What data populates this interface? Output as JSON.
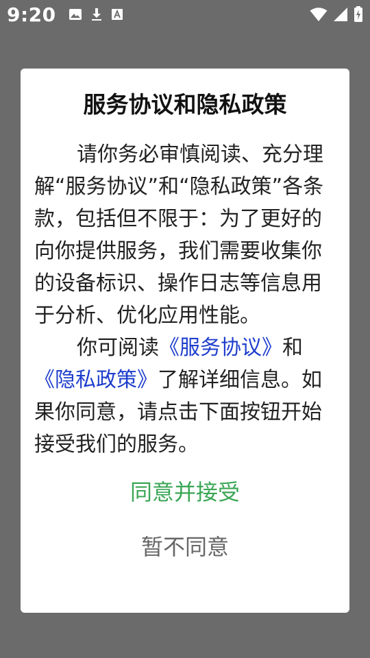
{
  "status_bar": {
    "time": "9:20",
    "icons_left": [
      "image-icon",
      "download-icon",
      "font-a-icon"
    ],
    "icons_right": [
      "wifi-icon",
      "signal-icon",
      "battery-charging-icon"
    ]
  },
  "dialog": {
    "title": "服务协议和隐私政策",
    "paragraph1": "请你务必审慎阅读、充分理解“服务协议”和“隐私政策”各条款，包括但不限于：为了更好的向你提供服务，我们需要收集你的设备标识、操作日志等信息用于分析、优化应用性能。",
    "paragraph2_prefix": "你可阅读",
    "link_service": "《服务协议》",
    "paragraph2_and": "和",
    "link_privacy": "《隐私政策》",
    "paragraph2_suffix": "了解详细信息。如果你同意，请点击下面按钮开始接受我们的服务。",
    "agree_button": "同意并接受",
    "disagree_button": "暂不同意"
  },
  "colors": {
    "backdrop": "#6b6b6b",
    "link": "#1e3ecc",
    "agree": "#3aa655",
    "disagree": "#666666"
  }
}
